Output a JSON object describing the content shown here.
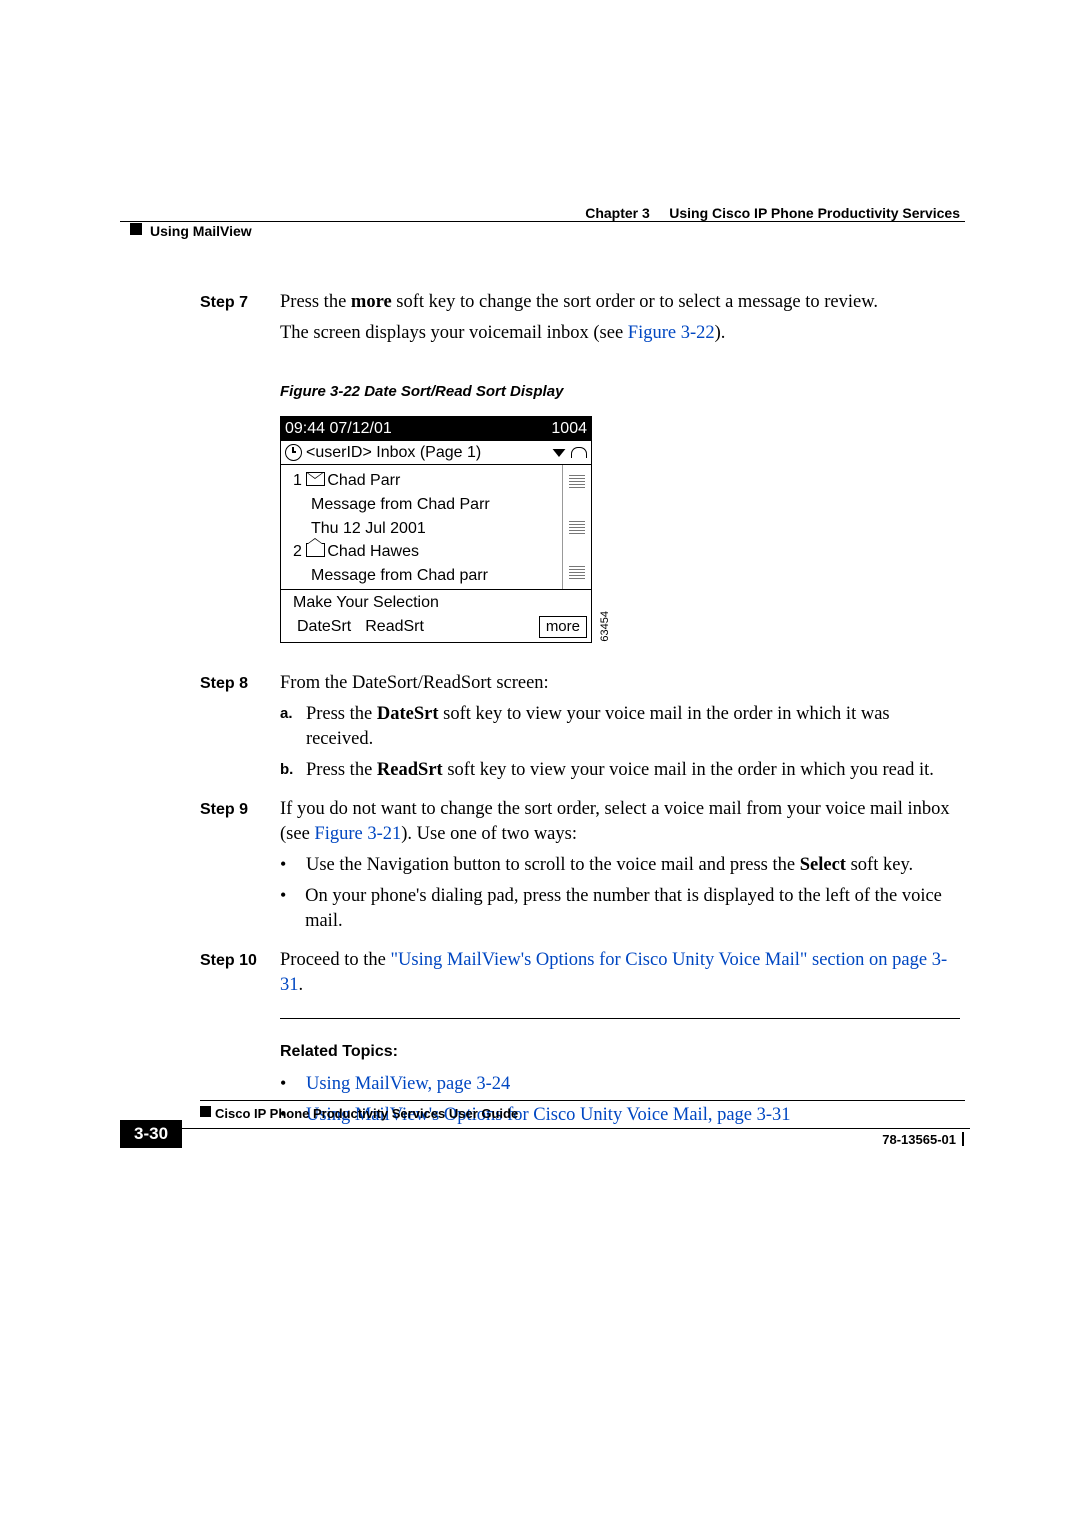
{
  "header": {
    "chapter": "Chapter 3",
    "chapter_title": "Using Cisco IP Phone Productivity Services",
    "section": "Using MailView"
  },
  "steps": {
    "s7": {
      "label": "Step 7",
      "p1_a": "Press the ",
      "p1_b": "more",
      "p1_c": " soft key to change the sort order or to select a message to review.",
      "p2_a": "The screen displays your voicemail inbox (see ",
      "p2_link": "Figure 3-22",
      "p2_b": ")."
    },
    "s8": {
      "label": "Step 8",
      "intro": "From the DateSort/ReadSort screen:",
      "a_pre": "Press the ",
      "a_bold": "DateSrt",
      "a_post": " soft key to view your voice mail in the order in which it was received.",
      "b_pre": "Press the ",
      "b_bold": "ReadSrt",
      "b_post": " soft key to view your voice mail in the order in which you read it."
    },
    "s9": {
      "label": "Step 9",
      "p1_a": "If you do not want to change the sort order, select a voice mail from your voice mail inbox (see ",
      "p1_link": "Figure 3-21",
      "p1_b": "). Use one of two ways:",
      "b1_a": "Use the Navigation button to scroll to the voice mail and press the ",
      "b1_bold": "Select",
      "b1_b": " soft key.",
      "b2": "On your phone's dialing pad, press the number that is displayed to the left of the voice mail."
    },
    "s10": {
      "label": "Step 10",
      "pre": "Proceed to the ",
      "link": "\"Using MailView's Options for Cisco Unity Voice Mail\" section on page 3-31",
      "post": "."
    }
  },
  "figure": {
    "caption": "Figure 3-22   Date Sort/Read Sort Display",
    "time": "09:44 07/12/01",
    "ext": "1004",
    "title": "<userID> Inbox (Page 1)",
    "row1_num": "1",
    "row1_name": "Chad Parr",
    "row1_msg": "Message from Chad Parr",
    "row1_date": "Thu 12 Jul 2001",
    "row2_num": "2",
    "row2_name": "Chad Hawes",
    "row2_msg": "Message from Chad parr",
    "prompt": "Make Your Selection",
    "sk1": "DateSrt",
    "sk2": "ReadSrt",
    "sk3": "more",
    "sidecode": "63454"
  },
  "related": {
    "title": "Related Topics:",
    "r1": "Using MailView, page 3-24",
    "r2": "Using MailView's Options for Cisco Unity Voice Mail, page 3-31"
  },
  "footer": {
    "doc_title": "Cisco IP Phone Productivity Services User Guide",
    "page_num": "3-30",
    "doc_num": "78-13565-01"
  },
  "letters": {
    "a": "a.",
    "b": "b."
  },
  "bullet": "•"
}
